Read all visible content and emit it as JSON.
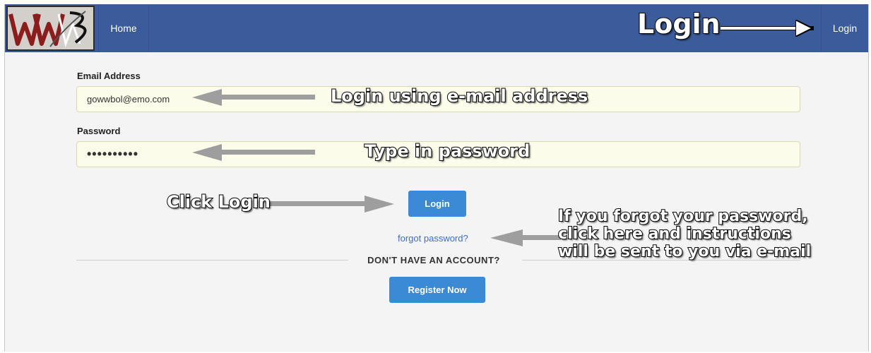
{
  "logo": {
    "text": "WWB"
  },
  "nav": {
    "home": "Home",
    "login": "Login"
  },
  "form": {
    "email_label": "Email Address",
    "email_value": "gowwbol@emo.com",
    "password_label": "Password",
    "password_value": "••••••••••",
    "login_button": "Login",
    "forgot_link": "forgot password?",
    "no_account": "DON'T HAVE AN ACCOUNT?",
    "register_button": "Register Now"
  },
  "annotations": {
    "login": "Login",
    "email": "Login using e-mail address",
    "password": "Type in password",
    "click_login": "Click Login",
    "forgot_line1": "If you forgot your password,",
    "forgot_line2": "click here and instructions",
    "forgot_line3": "will be sent to you via e-mail"
  },
  "colors": {
    "navbar": "#3b5b9a",
    "button": "#3a8ad6",
    "field_bg": "#fcfcea",
    "link": "#3a6fc4",
    "arrow_gray": "#9e9e9e"
  }
}
